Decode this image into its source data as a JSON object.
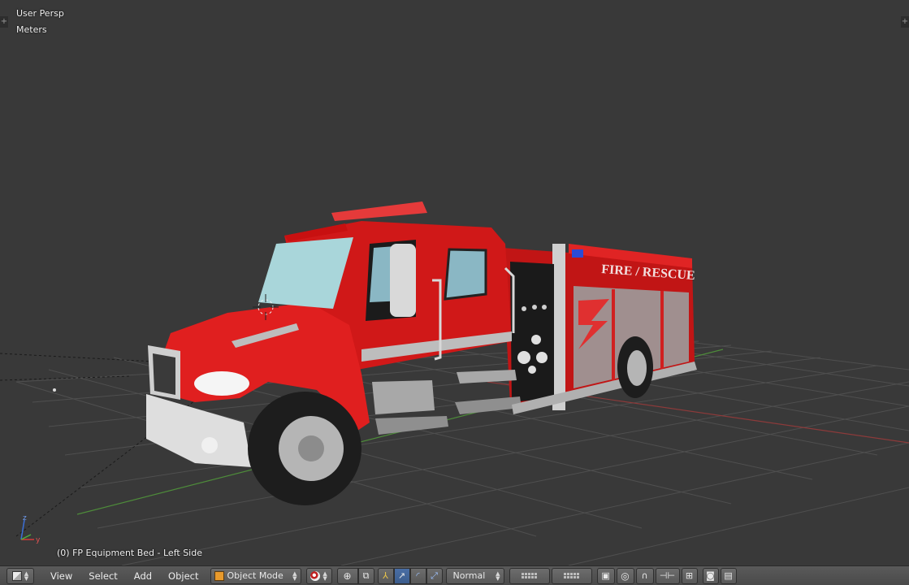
{
  "viewport": {
    "view_name": "User Persp",
    "unit_name": "Meters",
    "active_object": "(0) FP Equipment Bed - Left Side",
    "truck_text": "FIRE / RESCUE",
    "colors": {
      "background": "#393939",
      "grid": "#4f4f4f",
      "x_axis": "#8c3a3a",
      "y_axis": "#4e8c3a",
      "truck_red": "#d01818"
    }
  },
  "header": {
    "editor_type_icon": "cube-icon",
    "menus": [
      "View",
      "Select",
      "Add",
      "Object"
    ],
    "mode": "Object Mode",
    "shading_icon": "sphere-shading-icon",
    "pivot_icon": "pivot-icon",
    "transform_icons": [
      "manipulator-icon",
      "translate-icon",
      "rotate-icon",
      "scale-icon"
    ],
    "orientation": "Normal",
    "layer_groups": 2,
    "right_icons": [
      "lock-icon",
      "proportional-icon",
      "snap-icon",
      "snap-target-icon",
      "snap-options-icon",
      "render-icon",
      "clapper-icon"
    ]
  }
}
